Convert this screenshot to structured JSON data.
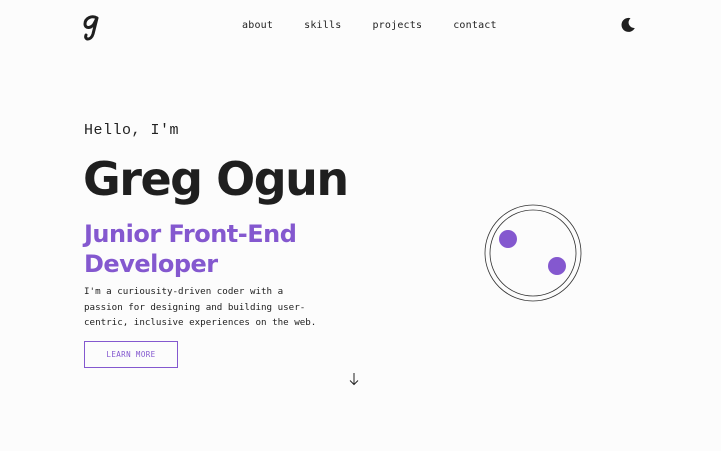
{
  "header": {
    "logo_icon": "cursive-g-logo",
    "nav": [
      {
        "label": "about"
      },
      {
        "label": "skills"
      },
      {
        "label": "projects"
      },
      {
        "label": "contact"
      }
    ],
    "theme_toggle_icon": "moon-icon"
  },
  "hero": {
    "greeting": "Hello, I'm",
    "name": "Greg Ogun",
    "role": "Junior Front-End Developer",
    "bio": "I'm a curiousity-driven coder with a passion for designing and building user-centric, inclusive experiences on the web.",
    "cta_label": "LEARN MORE",
    "scroll_icon": "arrow-down-icon"
  },
  "decoration": {
    "orbit_icon": "orbit-graphic"
  },
  "colors": {
    "accent": "#8458cf",
    "text": "#222222",
    "background": "#fcfcfc"
  }
}
